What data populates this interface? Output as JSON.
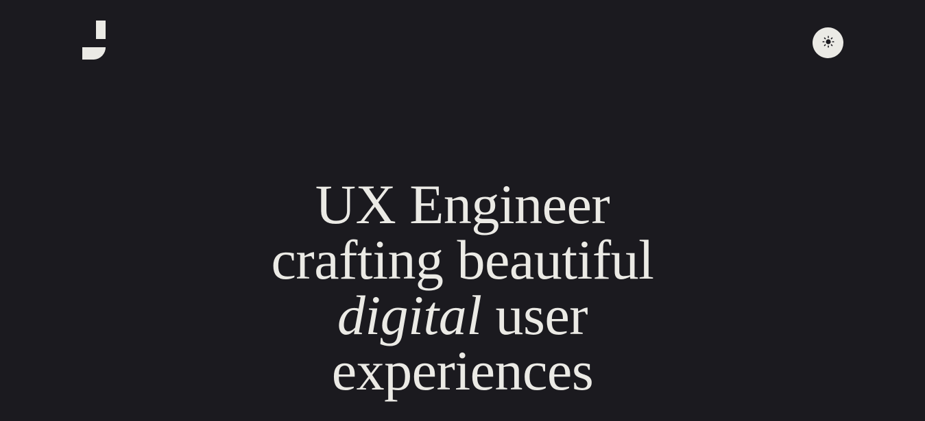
{
  "header": {
    "logo_icon": "j-letter-logo-icon",
    "theme_toggle_icon": "sun-icon"
  },
  "hero": {
    "line1": "UX Engineer",
    "line2": "crafting beautiful",
    "line3_italic": "digital",
    "line3_rest": " user",
    "line4": "experiences"
  },
  "colors": {
    "background": "#1b1a1f",
    "foreground": "#ebeae5"
  }
}
